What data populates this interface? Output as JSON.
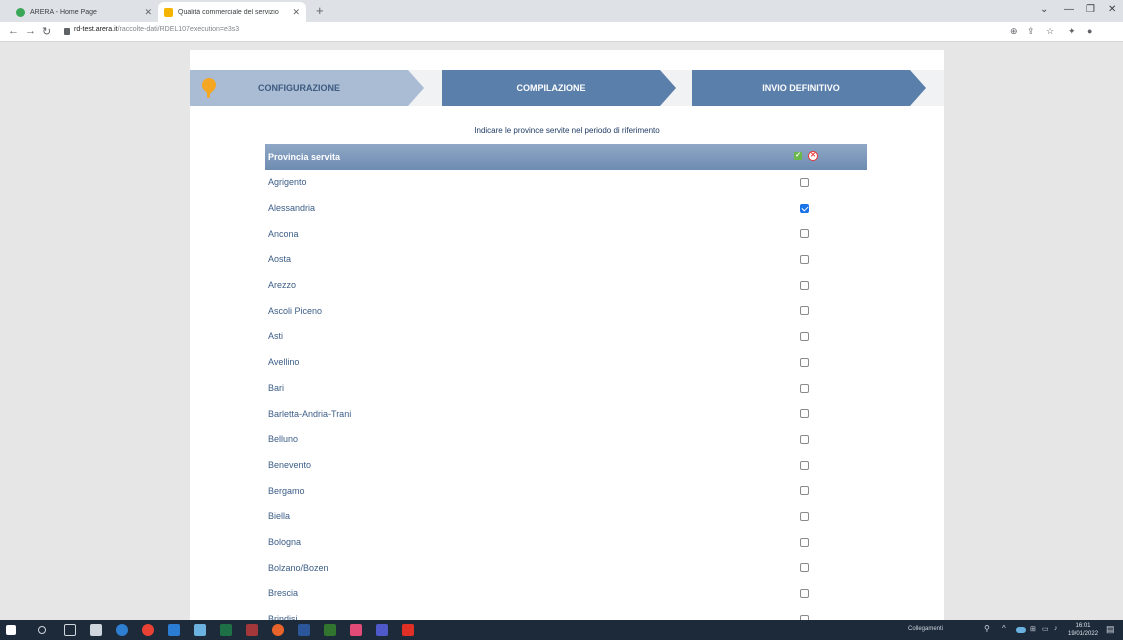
{
  "browser": {
    "tabs": [
      {
        "title": "ARERA - Home Page",
        "icon": "arera-favicon-icon",
        "active": false
      },
      {
        "title": "Qualità commerciale del servizio",
        "icon": "arera-doc-favicon-icon",
        "active": true
      }
    ],
    "url_host": "rd-test.arera.it",
    "url_path": "/raccolte-dati/RDEL107execution=e3s3"
  },
  "wizard": {
    "steps": [
      "CONFIGURAZIONE",
      "COMPILAZIONE",
      "INVIO DEFINITIVO"
    ],
    "active_step": "CONFIGURAZIONE"
  },
  "instruction": "Indicare le province servite nel periodo di riferimento",
  "table": {
    "header": "Provincia servita",
    "rows": [
      {
        "name": "Agrigento",
        "checked": false
      },
      {
        "name": "Alessandria",
        "checked": true
      },
      {
        "name": "Ancona",
        "checked": false
      },
      {
        "name": "Aosta",
        "checked": false
      },
      {
        "name": "Arezzo",
        "checked": false
      },
      {
        "name": "Ascoli Piceno",
        "checked": false
      },
      {
        "name": "Asti",
        "checked": false
      },
      {
        "name": "Avellino",
        "checked": false
      },
      {
        "name": "Bari",
        "checked": false
      },
      {
        "name": "Barletta-Andria-Trani",
        "checked": false
      },
      {
        "name": "Belluno",
        "checked": false
      },
      {
        "name": "Benevento",
        "checked": false
      },
      {
        "name": "Bergamo",
        "checked": false
      },
      {
        "name": "Biella",
        "checked": false
      },
      {
        "name": "Bologna",
        "checked": false
      },
      {
        "name": "Bolzano/Bozen",
        "checked": false
      },
      {
        "name": "Brescia",
        "checked": false
      },
      {
        "name": "Brindisi",
        "checked": false
      }
    ]
  },
  "taskbar": {
    "links_label": "Collegamenti",
    "time": "16:01",
    "date": "19/01/2022"
  },
  "colors": {
    "accent": "#5b7fab",
    "header_gradient_top": "#90a8c6",
    "checkbox_checked": "#1a73e8"
  }
}
